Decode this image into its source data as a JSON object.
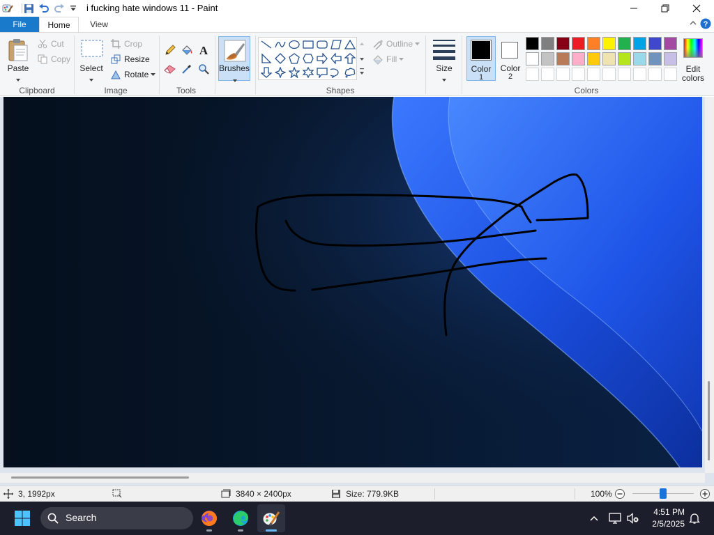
{
  "window": {
    "title": "i fucking hate windows 11 - Paint",
    "controls": {
      "minimize": "minimize",
      "maximize": "maximize",
      "close": "close"
    }
  },
  "tabs": [
    "File",
    "Home",
    "View"
  ],
  "ribbon": {
    "clipboard": {
      "label": "Clipboard",
      "paste": "Paste",
      "cut": "Cut",
      "copy": "Copy"
    },
    "image": {
      "label": "Image",
      "select": "Select",
      "crop": "Crop",
      "resize": "Resize",
      "rotate": "Rotate"
    },
    "tools": {
      "label": "Tools",
      "items": [
        "pencil-icon",
        "fill-icon",
        "text-icon",
        "eraser-icon",
        "color-picker-icon",
        "magnifier-icon"
      ]
    },
    "brushes": {
      "label": "Brushes"
    },
    "shapes": {
      "label": "Shapes",
      "outline": "Outline",
      "fill": "Fill"
    },
    "size": {
      "label": "Size"
    },
    "color1": {
      "label_line1": "Color",
      "label_line2": "1",
      "value": "#000000"
    },
    "color2": {
      "label_line1": "Color",
      "label_line2": "2",
      "value": "#ffffff"
    },
    "colors": {
      "label": "Colors",
      "edit_label_line1": "Edit",
      "edit_label_line2": "colors",
      "row1": [
        "#000000",
        "#7f7f7f",
        "#880015",
        "#ed1c24",
        "#ff7f27",
        "#fff200",
        "#22b14c",
        "#00a2e8",
        "#3f48cc",
        "#a349a4"
      ],
      "row2": [
        "#ffffff",
        "#c3c3c3",
        "#b97a57",
        "#ffaec9",
        "#ffc90e",
        "#efe4b0",
        "#b5e61d",
        "#99d9ea",
        "#7092be",
        "#c8bfe7"
      ]
    }
  },
  "statusbar": {
    "position": "3, 1992px",
    "dimensions": "3840 × 2400px",
    "size": "Size: 779.9KB",
    "zoom": "100%",
    "zoom_level": 0.5
  },
  "taskbar": {
    "search_label": "Search",
    "apps": [
      "firefox-icon",
      "edge-icon",
      "paint-icon"
    ],
    "time": "4:51 PM",
    "date": "2/5/2025"
  }
}
